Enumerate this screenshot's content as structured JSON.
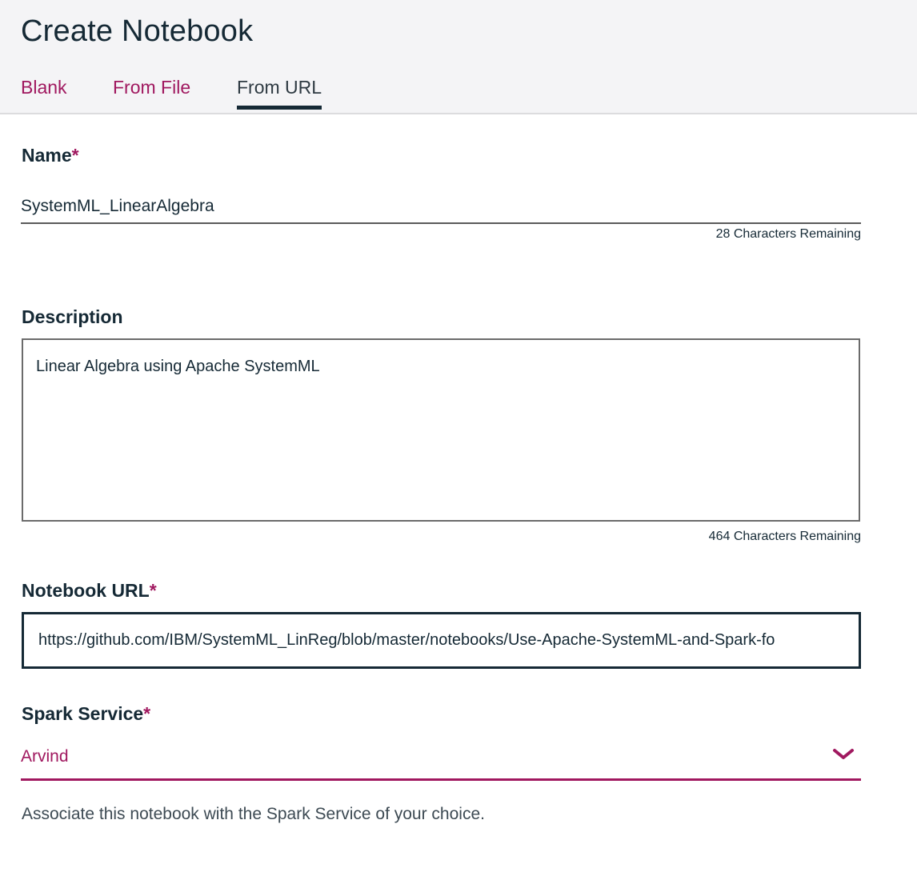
{
  "header": {
    "title": "Create Notebook",
    "tabs": [
      {
        "label": "Blank"
      },
      {
        "label": "From File"
      },
      {
        "label": "From URL"
      }
    ]
  },
  "form": {
    "name": {
      "label": "Name",
      "required": "*",
      "value": "SystemML_LinearAlgebra",
      "counter": "28 Characters Remaining"
    },
    "description": {
      "label": "Description",
      "value": "Linear Algebra using Apache SystemML",
      "counter": "464 Characters Remaining"
    },
    "notebook_url": {
      "label": "Notebook URL",
      "required": "*",
      "value": "https://github.com/IBM/SystemML_LinReg/blob/master/notebooks/Use-Apache-SystemML-and-Spark-fo"
    },
    "spark_service": {
      "label": "Spark Service",
      "required": "*",
      "value": "Arvind",
      "icon": "chevron-down-icon",
      "help": "Associate this notebook with the Spark Service of your choice."
    }
  },
  "colors": {
    "accent": "#a0185f",
    "text": "#152935",
    "header_bg": "#f4f4f6"
  }
}
